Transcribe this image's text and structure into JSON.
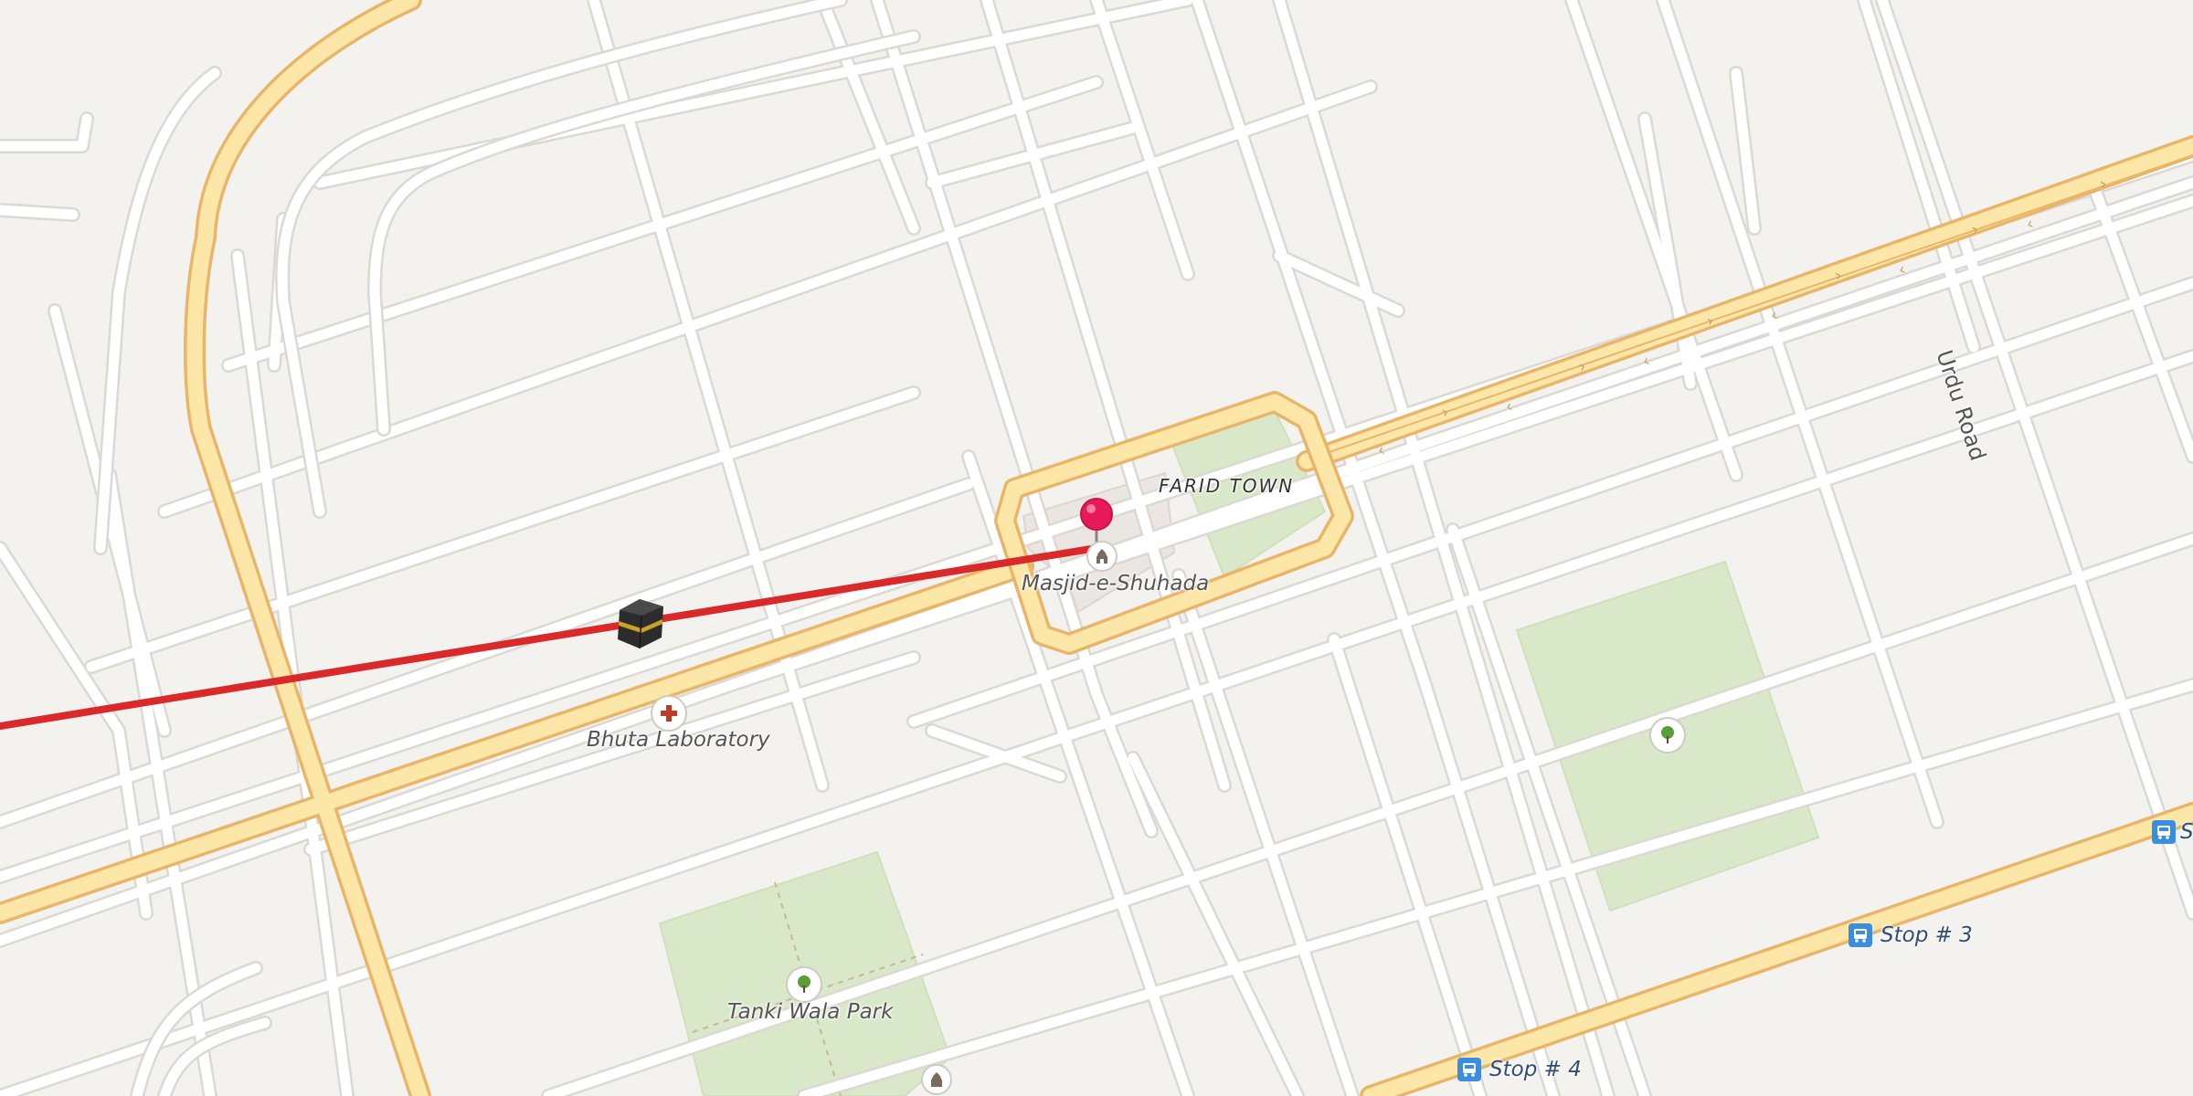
{
  "map": {
    "area_label": "FARID TOWN",
    "road_label": "Urdu Road",
    "places": {
      "mosque_main": "Masjid-e-Shuhada",
      "lab": "Bhuta Laboratory",
      "park": "Tanki Wala Park"
    },
    "bus_stops": {
      "stop3": "Stop # 3",
      "stop4": "Stop # 4",
      "stop_edge": "S"
    },
    "icons": {
      "pin": "location-pin-icon",
      "kaaba": "kaaba-icon",
      "mosque": "mosque-icon",
      "medical": "medical-cross-icon",
      "tree": "tree-icon",
      "bus": "bus-icon"
    },
    "colors": {
      "background": "#f4f2ef",
      "park": "#d9e8c9",
      "major_road": "#fde7a8",
      "major_road_casing": "#e8b66a",
      "qibla_line": "#d9292b",
      "pin": "#e8195a",
      "bus_stop": "#3b8de0"
    }
  }
}
